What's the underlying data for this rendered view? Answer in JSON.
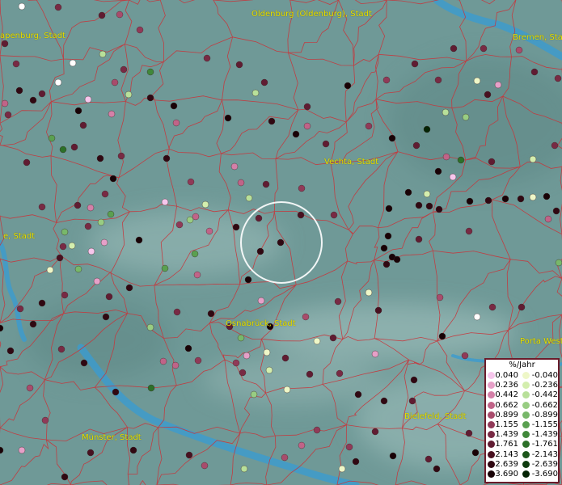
{
  "map": {
    "places": [
      "Oldenburg (Oldenburg), Stadt",
      "apenburg, Stadt",
      "Bremen, Stadt",
      "Vechta, Stadt",
      "e, Stadt",
      "Osnabrück, Stadt",
      "Porta West",
      "Bielefeld, Stadt",
      "Münster, Stadt"
    ]
  },
  "legend": {
    "title": "%/Jahr",
    "rows": [
      {
        "pos": "0.040",
        "neg": "-0.040",
        "pos_color": "#f6c6ec",
        "neg_color": "#eef7c8"
      },
      {
        "pos": "0.236",
        "neg": "-0.236",
        "pos_color": "#e6a0c8",
        "neg_color": "#d3eeae"
      },
      {
        "pos": "0.442",
        "neg": "-0.442",
        "pos_color": "#d480a8",
        "neg_color": "#b8e09a"
      },
      {
        "pos": "0.662",
        "neg": "-0.662",
        "pos_color": "#c06488",
        "neg_color": "#98cd82"
      },
      {
        "pos": "0.899",
        "neg": "-0.899",
        "pos_color": "#a84c6c",
        "neg_color": "#78b86a"
      },
      {
        "pos": "1.155",
        "neg": "-1.155",
        "pos_color": "#903a58",
        "neg_color": "#5aa050"
      },
      {
        "pos": "1.439",
        "neg": "-1.439",
        "pos_color": "#782a44",
        "neg_color": "#40883a"
      },
      {
        "pos": "1.761",
        "neg": "-1.761",
        "pos_color": "#601c32",
        "neg_color": "#2c7028"
      },
      {
        "pos": "2.143",
        "neg": "-2.143",
        "pos_color": "#481020",
        "neg_color": "#1c561a"
      },
      {
        "pos": "2.639",
        "neg": "-2.639",
        "pos_color": "#300812",
        "neg_color": "#0e3c0e"
      },
      {
        "pos": "3.690",
        "neg": "-3.690",
        "pos_color": "#180206",
        "neg_color": "#042404"
      }
    ]
  }
}
